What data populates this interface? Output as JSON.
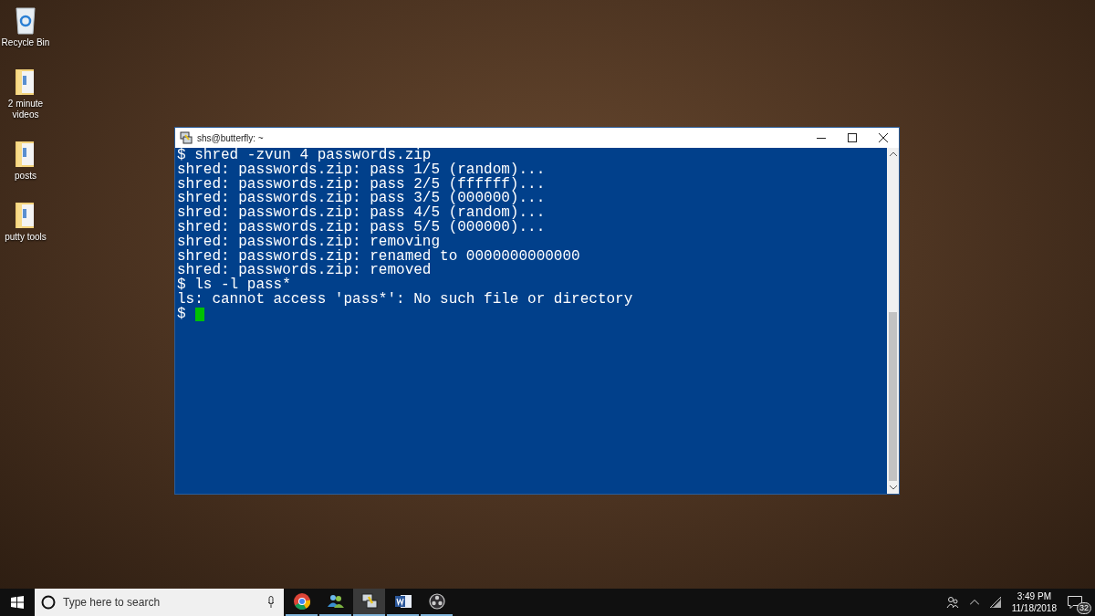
{
  "desktop_icons": [
    {
      "kind": "recycle",
      "label": "Recycle Bin"
    },
    {
      "kind": "folder",
      "label": "2 minute videos"
    },
    {
      "kind": "folder",
      "label": "posts"
    },
    {
      "kind": "folder",
      "label": "putty tools"
    }
  ],
  "window": {
    "title": "shs@butterfly: ~"
  },
  "terminal": {
    "lines": [
      "$ shred -zvun 4 passwords.zip",
      "shred: passwords.zip: pass 1/5 (random)...",
      "shred: passwords.zip: pass 2/5 (ffffff)...",
      "shred: passwords.zip: pass 3/5 (000000)...",
      "shred: passwords.zip: pass 4/5 (random)...",
      "shred: passwords.zip: pass 5/5 (000000)...",
      "shred: passwords.zip: removing",
      "shred: passwords.zip: renamed to 0000000000000",
      "shred: passwords.zip: removed",
      "$ ls -l pass*",
      "ls: cannot access 'pass*': No such file or directory"
    ],
    "prompt": "$"
  },
  "taskbar": {
    "search": {
      "placeholder": "Type here to search"
    },
    "apps": [
      {
        "kind": "browser",
        "selected": false
      },
      {
        "kind": "people",
        "selected": false
      },
      {
        "kind": "terminal",
        "selected": true
      },
      {
        "kind": "word",
        "selected": false
      },
      {
        "kind": "recorder",
        "selected": false
      }
    ],
    "time": "3:49 PM",
    "date": "11/18/2018",
    "notifications": "32"
  }
}
